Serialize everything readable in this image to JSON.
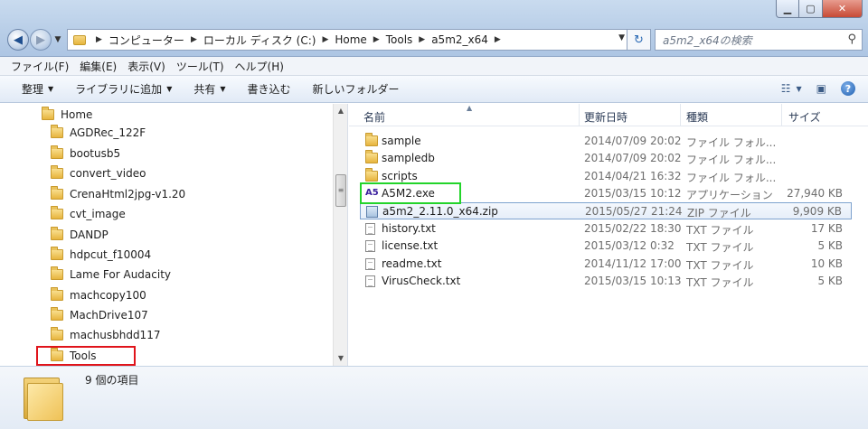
{
  "window": {
    "min_icon": "minimize-icon",
    "max_icon": "maximize-icon",
    "close_icon": "close-icon"
  },
  "address": {
    "crumbs": [
      "コンピューター",
      "ローカル ディスク (C:)",
      "Home",
      "Tools",
      "a5m2_x64"
    ],
    "search_placeholder": "a5m2_x64の検索"
  },
  "menu": [
    "ファイル(F)",
    "編集(E)",
    "表示(V)",
    "ツール(T)",
    "ヘルプ(H)"
  ],
  "toolbar": {
    "organize": "整理",
    "add_to_library": "ライブラリに追加",
    "share": "共有",
    "burn": "書き込む",
    "new_folder": "新しいフォルダー"
  },
  "nav": {
    "items": [
      "Home",
      "AGDRec_122F",
      "bootusb5",
      "convert_video",
      "CrenaHtml2jpg-v1.20",
      "cvt_image",
      "DANDP",
      "hdpcut_f10004",
      "Lame For Audacity",
      "machcopy100",
      "MachDrive107",
      "machusbhdd117",
      "Tools"
    ]
  },
  "columns": {
    "name": "名前",
    "date": "更新日時",
    "type": "種類",
    "size": "サイズ"
  },
  "files": [
    {
      "name": "sample",
      "date": "2014/07/09 20:02",
      "type": "ファイル フォル...",
      "size": "",
      "icon": "folder-icon"
    },
    {
      "name": "sampledb",
      "date": "2014/07/09 20:02",
      "type": "ファイル フォル...",
      "size": "",
      "icon": "folder-icon"
    },
    {
      "name": "scripts",
      "date": "2014/04/21 16:32",
      "type": "ファイル フォル...",
      "size": "",
      "icon": "folder-icon"
    },
    {
      "name": "A5M2.exe",
      "date": "2015/03/15 10:12",
      "type": "アプリケーション",
      "size": "27,940 KB",
      "icon": "app-icon"
    },
    {
      "name": "a5m2_2.11.0_x64.zip",
      "date": "2015/05/27 21:24",
      "type": "ZIP ファイル",
      "size": "9,909 KB",
      "icon": "zip-icon"
    },
    {
      "name": "history.txt",
      "date": "2015/02/22 18:30",
      "type": "TXT ファイル",
      "size": "17 KB",
      "icon": "text-file-icon"
    },
    {
      "name": "license.txt",
      "date": "2015/03/12 0:32",
      "type": "TXT ファイル",
      "size": "5 KB",
      "icon": "text-file-icon"
    },
    {
      "name": "readme.txt",
      "date": "2014/11/12 17:00",
      "type": "TXT ファイル",
      "size": "10 KB",
      "icon": "text-file-icon"
    },
    {
      "name": "VirusCheck.txt",
      "date": "2015/03/15 10:13",
      "type": "TXT ファイル",
      "size": "5 KB",
      "icon": "text-file-icon"
    }
  ],
  "status": {
    "count": "9 個の項目"
  },
  "colors": {
    "highlight_red": "#e0141b",
    "highlight_green": "#23d42a"
  }
}
